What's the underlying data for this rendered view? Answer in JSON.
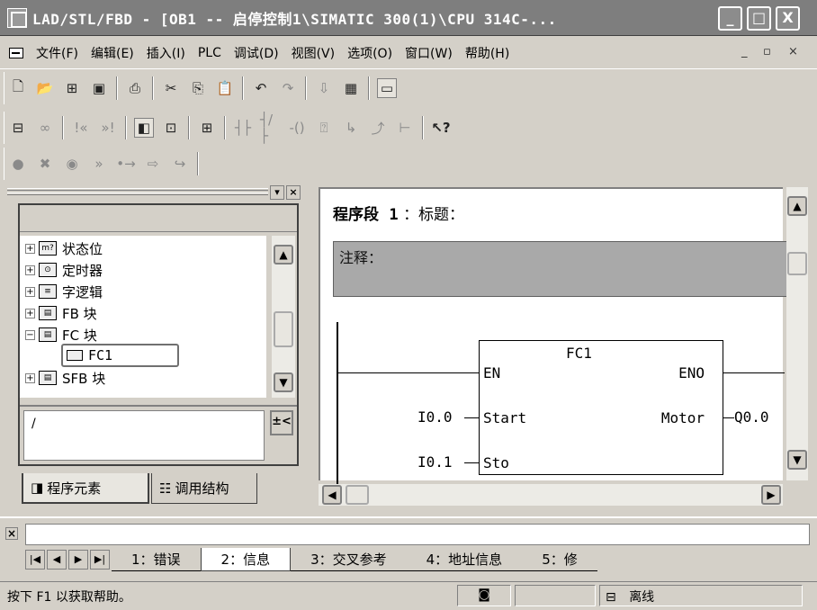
{
  "window": {
    "title": "LAD/STL/FBD  - [OB1 -- 启停控制1\\SIMATIC 300(1)\\CPU 314C-...",
    "controls": [
      "_",
      "□",
      "X"
    ]
  },
  "menubar": {
    "items": [
      "文件(F)",
      "编辑(E)",
      "插入(I)",
      "PLC",
      "调试(D)",
      "视图(V)",
      "选项(O)",
      "窗口(W)",
      "帮助(H)"
    ],
    "mdi_controls": [
      "_",
      "▫",
      "×"
    ]
  },
  "toolbar1": {
    "icons": [
      "new-icon",
      "open-icon",
      "accessible-nodes-icon",
      "save-icon",
      "print-icon",
      "cut-icon",
      "copy-icon",
      "paste-icon",
      "undo-icon",
      "redo-icon",
      "download-icon",
      "monitor-icon",
      "overview-icon"
    ]
  },
  "toolbar2": {
    "icons": [
      "network-icon",
      "glasses-icon",
      "prev-network-icon",
      "next-network-icon",
      "program-elements-icon",
      "details-icon",
      "new-network-icon",
      "no-contact-icon",
      "nc-contact-icon",
      "coil-icon",
      "empty-box-icon",
      "open-branch-icon",
      "close-branch-icon",
      "connection-icon",
      "help-pointer-icon"
    ]
  },
  "toolbar3": {
    "icons": [
      "breakpoint-icon",
      "delete-breakpoint-icon",
      "activate-icon",
      "step-icon",
      "resume-icon",
      "execute-next-icon",
      "execute-call-icon"
    ]
  },
  "left_pane": {
    "tree_items": [
      {
        "label": "状态位",
        "icon": "status-bit-icon",
        "expanded": false
      },
      {
        "label": "定时器",
        "icon": "timer-icon",
        "expanded": false
      },
      {
        "label": "字逻辑",
        "icon": "word-logic-icon",
        "expanded": false
      },
      {
        "label": "FB 块",
        "icon": "fb-block-icon",
        "expanded": false
      },
      {
        "label": "FC 块",
        "icon": "fc-block-icon",
        "expanded": true
      },
      {
        "label": "FC1",
        "icon": "fc1-block-icon",
        "child": true,
        "selected": true
      },
      {
        "label": "SFB 块",
        "icon": "sfb-block-icon",
        "expanded": false
      }
    ],
    "path_value": "/",
    "path_button": "±<",
    "tabs": [
      "程序元素",
      "调用结构"
    ]
  },
  "editor": {
    "network_label": "程序段",
    "network_number": "1",
    "network_title": "：标题：",
    "comment_label": "注释：",
    "block": {
      "name": "FC1",
      "en": "EN",
      "eno": "ENO",
      "inputs": [
        {
          "pin": "Start",
          "operand": "I0.0"
        },
        {
          "pin": "Sto",
          "operand": "I0.1"
        }
      ],
      "outputs": [
        {
          "pin": "Motor",
          "operand": "Q0.0"
        }
      ]
    }
  },
  "output": {
    "close": "×",
    "tabs": [
      "1：错误",
      "2：信息",
      "3：交叉参考",
      "4：地址信息",
      "5：修"
    ],
    "active_tab_index": 1
  },
  "statusbar": {
    "help_text": "按下 F1 以获取帮助。",
    "mode": "离线"
  }
}
